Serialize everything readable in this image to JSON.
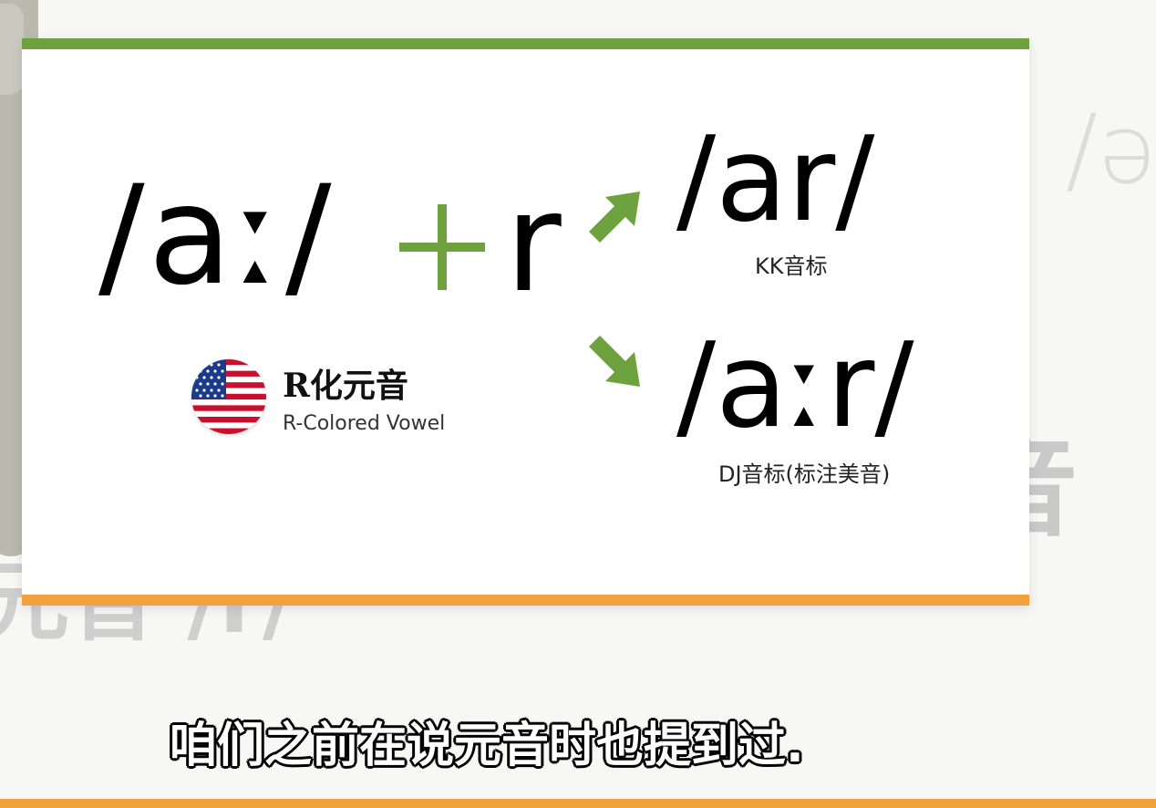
{
  "background": {
    "ipa_fragment": "/ə",
    "char_right": "音",
    "text_left": "元音 /r/"
  },
  "slide": {
    "ipa_base": "/aː/",
    "plus_symbol": "+",
    "r_letter": "r",
    "kk_ipa": "/ar/",
    "kk_label": "KK音标",
    "dj_ipa": "/aːr/",
    "dj_label": "DJ音标(标注美音)",
    "flag_title": "R化元音",
    "flag_subtitle": "R-Colored Vowel",
    "flag_icon": "us-flag-icon",
    "accent_green": "#6ea23f",
    "accent_orange": "#f0a13b"
  },
  "subtitle": "咱们之前在说元音时也提到过."
}
